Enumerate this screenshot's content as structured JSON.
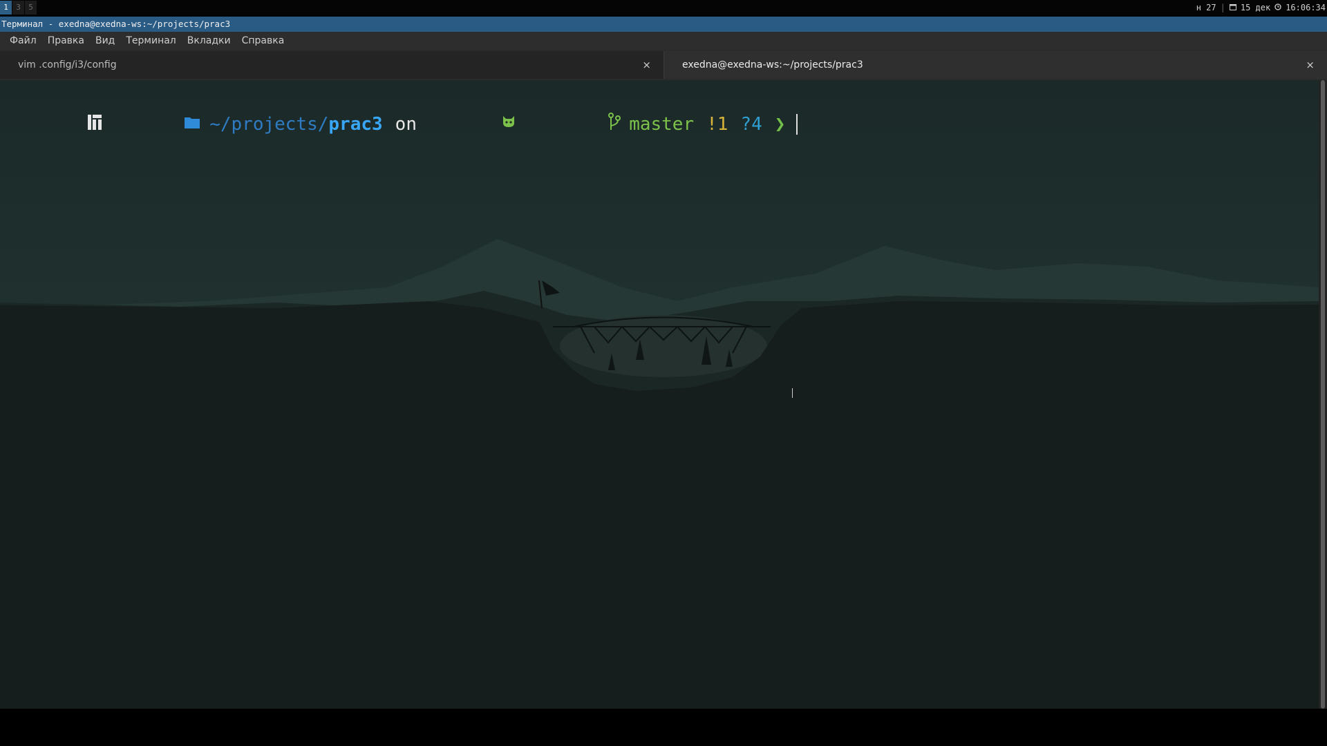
{
  "i3bar": {
    "workspaces": [
      {
        "label": "1",
        "focused": true
      },
      {
        "label": "3",
        "focused": false
      },
      {
        "label": "5",
        "focused": false
      }
    ],
    "status": {
      "week": "н 27",
      "date": "15 дек",
      "time": "16:06:34",
      "calendar_icon": "calendar-icon",
      "clock_icon": "clock-icon"
    }
  },
  "window": {
    "title": "Терминал - exedna@exedna-ws:~/projects/prac3"
  },
  "menubar": {
    "items": [
      "Файл",
      "Правка",
      "Вид",
      "Терминал",
      "Вкладки",
      "Справка"
    ]
  },
  "tabs": [
    {
      "label": "vim .config/i3/config",
      "active": false,
      "close": "×"
    },
    {
      "label": "exedna@exedna-ws:~/projects/prac3",
      "active": true,
      "close": "×"
    }
  ],
  "prompt": {
    "os_icon": "manjaro-icon",
    "folder_icon": "folder-icon",
    "path_prefix": "~/projects/",
    "path_current": "prac3",
    "on": "on",
    "github_icon": "github-icon",
    "branch_icon": "git-branch-icon",
    "branch": "master",
    "modified": "!1",
    "untracked": "?4",
    "arrow": "❯"
  },
  "colors": {
    "titlebar": "#2a5b85",
    "path": "#39a6f5",
    "branch": "#7cc24a",
    "modified": "#d8b43a"
  }
}
